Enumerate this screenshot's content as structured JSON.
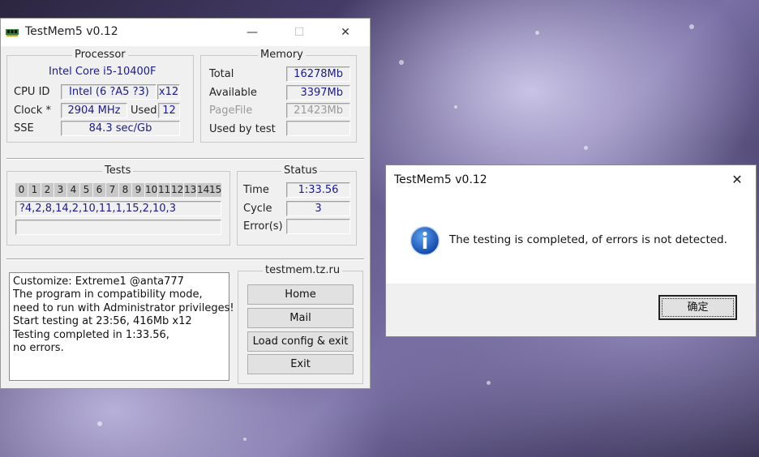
{
  "window": {
    "title": "TestMem5 v0.12",
    "minimize_icon": "—",
    "maximize_icon": "☐",
    "close_icon": "✕"
  },
  "processor": {
    "title": "Processor",
    "name": "Intel Core i5-10400F",
    "cpu_id_label": "CPU ID",
    "cpu_id": "Intel  (6 ?A5 ?3)",
    "threads": "x12",
    "clock_label": "Clock *",
    "clock": "2904 MHz",
    "used_label": "Used",
    "used": "12",
    "sse_label": "SSE",
    "sse": "84.3 sec/Gb"
  },
  "memory": {
    "title": "Memory",
    "total_label": "Total",
    "total": "16278Mb",
    "available_label": "Available",
    "available": "3397Mb",
    "pagefile_label": "PageFile",
    "pagefile": "21423Mb",
    "used_by_test_label": "Used by test",
    "used_by_test": ""
  },
  "tests": {
    "title": "Tests",
    "numbers": [
      "0",
      "1",
      "2",
      "3",
      "4",
      "5",
      "6",
      "7",
      "8",
      "9",
      "10",
      "11",
      "12",
      "13",
      "14",
      "15"
    ],
    "sequence": "?4,2,8,14,2,10,11,1,15,2,10,3",
    "progress": ""
  },
  "status": {
    "title": "Status",
    "time_label": "Time",
    "time": "1:33.56",
    "cycle_label": "Cycle",
    "cycle": "3",
    "errors_label": "Error(s)",
    "errors": ""
  },
  "log": [
    "Customize: Extreme1 @anta777",
    "The program in compatibility mode,",
    "need to run with Administrator privileges!",
    "Start testing at 23:56, 416Mb x12",
    "Testing completed in 1:33.56,",
    "no errors."
  ],
  "links": {
    "title": "testmem.tz.ru",
    "home": "Home",
    "mail": "Mail",
    "load_config": "Load config & exit",
    "exit": "Exit"
  },
  "dialog": {
    "title": "TestMem5 v0.12",
    "close_icon": "✕",
    "message": "The testing is completed, of errors is not detected.",
    "ok": "确定",
    "icon_name": "info-icon"
  },
  "colors": {
    "value_text": "#1a1a8c",
    "info_icon": "#1e63c8"
  }
}
